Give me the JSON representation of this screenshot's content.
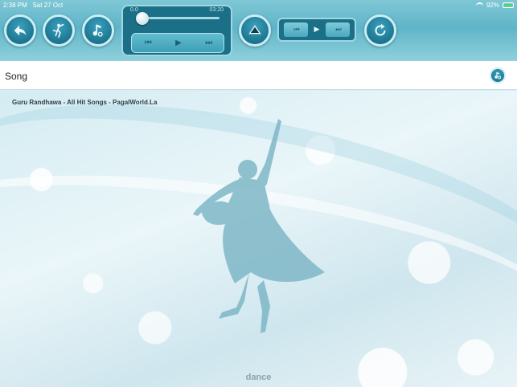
{
  "status_bar": {
    "time": "2:38 PM",
    "date": "Sat 27 Oct",
    "battery": "92%"
  },
  "toolbar": {
    "buttons": [
      {
        "name": "back",
        "icon": "back-arrow-icon"
      },
      {
        "name": "dancer",
        "icon": "dancer-icon"
      },
      {
        "name": "music",
        "icon": "music-note-icon"
      },
      {
        "name": "eject",
        "icon": "eject-icon"
      },
      {
        "name": "repeat",
        "icon": "repeat-icon"
      }
    ],
    "player": {
      "current_time": "0.0",
      "total_time": "03:20",
      "progress": 0.0,
      "rewind_glyph": "⏮",
      "play_glyph": "▶",
      "forward_glyph": "⏭"
    },
    "ab_loop": {
      "a_glyph": "⏮",
      "play_glyph": "▶",
      "b_glyph": "⏭"
    }
  },
  "song_bar": {
    "label": "Song",
    "icon": "music-note-icon"
  },
  "main": {
    "track_name": "Guru Randhawa - All Hit Songs - PagalWorld.La",
    "footer_label": "dance",
    "accent_color": "#1d7590",
    "background_color": "#dbeef3"
  }
}
